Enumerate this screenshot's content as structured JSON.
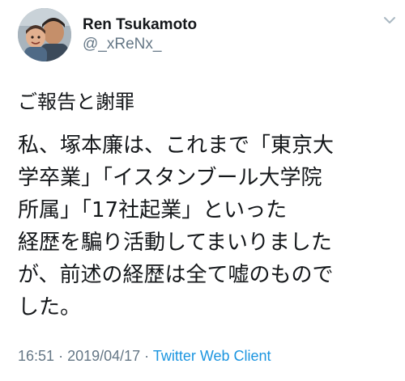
{
  "author": {
    "display_name": "Ren Tsukamoto",
    "handle": "@_xReNx_",
    "avatar_icon": "profile-photo-avatar"
  },
  "tweet": {
    "subject": "ご報告と謝罪",
    "lines": [
      "私、塚本廉は、これまで「東京大",
      "学卒業」「イスタンブール大学院",
      "所属」「17社起業」といった",
      "経歴を騙り活動してまいりました",
      "が、前述の経歴は全て嘘のもので",
      "した。"
    ]
  },
  "footer": {
    "time": "16:51",
    "separator": "·",
    "date": "2019/04/17",
    "client": "Twitter Web Client"
  },
  "colors": {
    "text": "#14171a",
    "secondary": "#657786",
    "link": "#1b95e0"
  },
  "icons": {
    "menu": "chevron-down-icon"
  }
}
